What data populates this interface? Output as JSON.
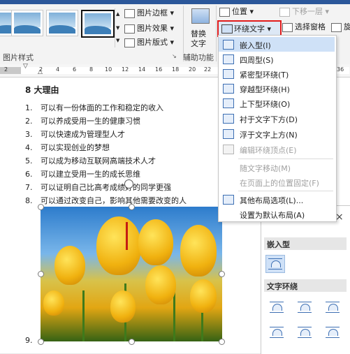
{
  "ribbon": {
    "picture_border": "图片边框",
    "picture_effects": "图片效果",
    "picture_layout": "图片版式",
    "picture_styles_label": "图片样式",
    "alt_text_line1": "替换",
    "alt_text_line2": "文字",
    "accessibility_label": "辅助功能",
    "position": "位置",
    "send_backward": "下移一层",
    "wrap_text": "环绕文字",
    "selection_pane": "选择窗格",
    "rotate": "旋",
    "dropdown_arrow": "▾"
  },
  "ruler": {
    "ticks": [
      "2",
      "2",
      "4",
      "6",
      "8",
      "10",
      "12",
      "14",
      "16",
      "18",
      "20",
      "22",
      "36"
    ]
  },
  "document": {
    "title": "8 大理由",
    "items": [
      {
        "num": "1.",
        "text": "可以有一份体面的工作和稳定的收入"
      },
      {
        "num": "2.",
        "text": "可以养成受用一生的健康习惯"
      },
      {
        "num": "3.",
        "text": "可以快速成为管理型人才"
      },
      {
        "num": "4.",
        "text": "可以实现创业的梦想"
      },
      {
        "num": "5.",
        "text": "可以成为移动互联网高端技术人才"
      },
      {
        "num": "6.",
        "text": "可以建立受用一生的成长思维"
      },
      {
        "num": "7.",
        "text": "可以证明自己比高考成绩好的同学更强"
      },
      {
        "num": "8.",
        "text": "可以通过改变自己，影响其他需要改变的人"
      }
    ],
    "item9": "9."
  },
  "wrap_menu": {
    "items": [
      {
        "label": "嵌入型(I)",
        "disabled": false
      },
      {
        "label": "四周型(S)",
        "disabled": false
      },
      {
        "label": "紧密型环绕(T)",
        "disabled": false
      },
      {
        "label": "穿越型环绕(H)",
        "disabled": false
      },
      {
        "label": "上下型环绕(O)",
        "disabled": false
      },
      {
        "label": "衬于文字下方(D)",
        "disabled": false
      },
      {
        "label": "浮于文字上方(N)",
        "disabled": false
      },
      {
        "label": "编辑环绕顶点(E)",
        "disabled": true
      },
      {
        "label": "随文字移动(M)",
        "disabled": true
      },
      {
        "label": "在页面上的位置固定(F)",
        "disabled": true
      },
      {
        "label": "其他布局选项(L)...",
        "disabled": false
      },
      {
        "label": "设置为默认布局(A)",
        "disabled": false
      }
    ]
  },
  "layout_pane": {
    "close": "×",
    "inline_heading": "嵌入型",
    "wrap_heading": "文字环绕"
  }
}
